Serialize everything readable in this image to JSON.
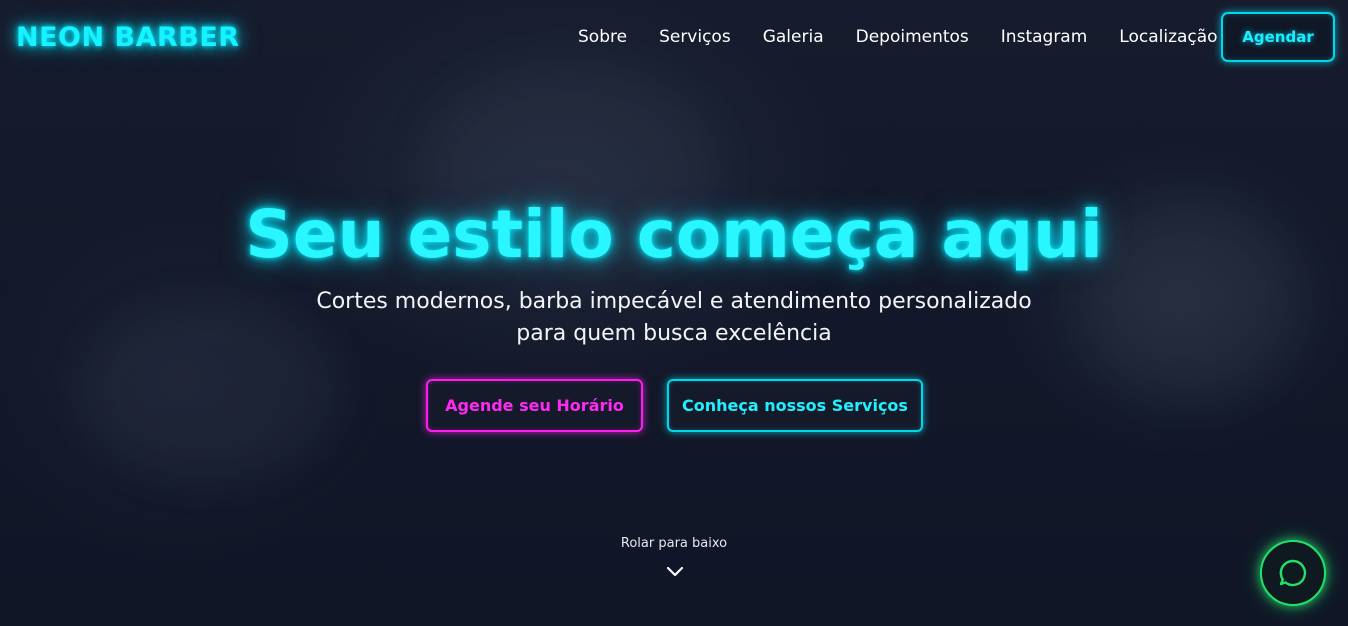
{
  "brand": {
    "logo": "NEON BARBER"
  },
  "nav": {
    "items": [
      "Sobre",
      "Serviços",
      "Galeria",
      "Depoimentos",
      "Instagram",
      "Localização"
    ],
    "cta": "Agendar"
  },
  "hero": {
    "title": "Seu estilo começa aqui",
    "subtitle": "Cortes modernos, barba impecável e atendimento personalizado para quem busca excelência",
    "primary_button": "Agende seu Horário",
    "secondary_button": "Conheça nossos Serviços"
  },
  "scroll": {
    "label": "Rolar para baixo",
    "icon": "chevron-down-icon"
  },
  "floating": {
    "icon": "whatsapp-icon"
  },
  "colors": {
    "background": "#141a2b",
    "neon_cyan": "#00eaff",
    "neon_magenta": "#ff1cf2",
    "whatsapp_green": "#22e06c"
  }
}
